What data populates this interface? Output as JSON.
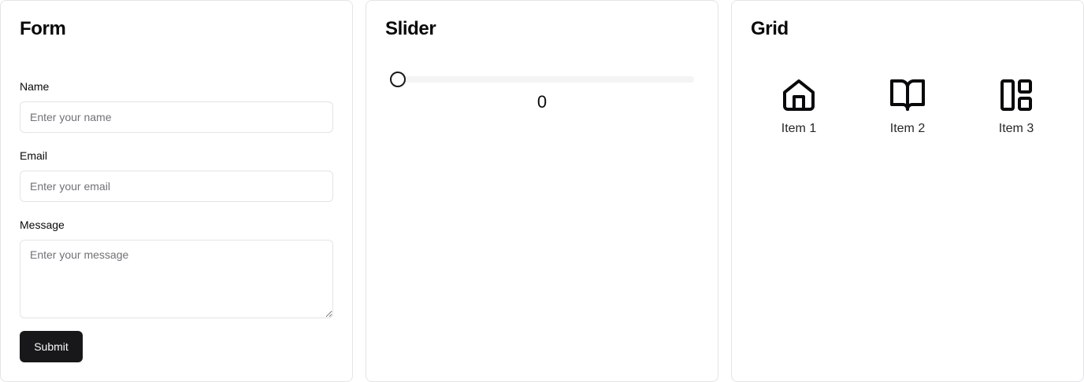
{
  "form": {
    "title": "Form",
    "name_label": "Name",
    "name_placeholder": "Enter your name",
    "name_value": "",
    "email_label": "Email",
    "email_placeholder": "Enter your email",
    "email_value": "",
    "message_label": "Message",
    "message_placeholder": "Enter your message",
    "message_value": "",
    "submit_label": "Submit"
  },
  "slider": {
    "title": "Slider",
    "value": "0"
  },
  "grid": {
    "title": "Grid",
    "items": [
      {
        "label": "Item 1",
        "icon": "home-icon"
      },
      {
        "label": "Item 2",
        "icon": "book-open-icon"
      },
      {
        "label": "Item 3",
        "icon": "layout-panel-left-icon"
      }
    ]
  },
  "colors": {
    "primary": "#18181b",
    "border": "#e4e4e7",
    "muted_text": "#71717a",
    "track": "#f4f4f5"
  }
}
